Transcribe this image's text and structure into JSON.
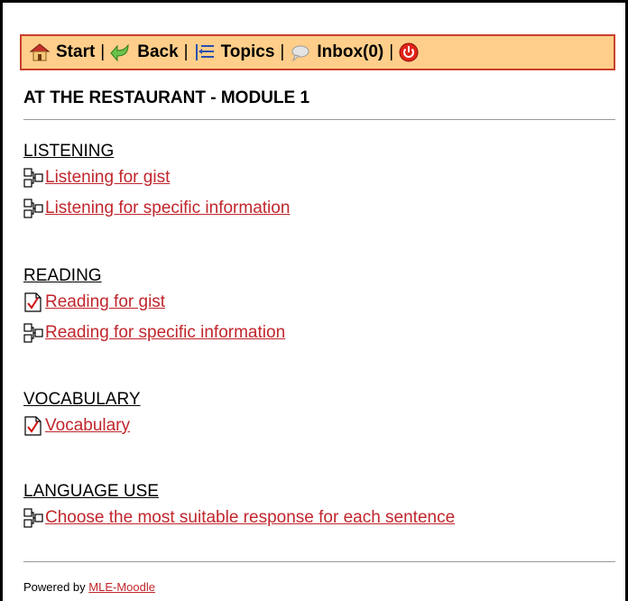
{
  "navbar": {
    "start_label": "Start",
    "back_label": "Back",
    "topics_label": "Topics",
    "inbox_label": "Inbox(0)",
    "separator": "|"
  },
  "page": {
    "title": "AT THE RESTAURANT - MODULE 1"
  },
  "sections": [
    {
      "heading": "LISTENING",
      "items": [
        {
          "icon": "hierarchy-icon",
          "label": "Listening for gist"
        },
        {
          "icon": "hierarchy-icon",
          "label": "Listening for specific information"
        }
      ]
    },
    {
      "heading": "READING",
      "items": [
        {
          "icon": "checked-document-icon",
          "label": "Reading for gist"
        },
        {
          "icon": "hierarchy-icon",
          "label": "Reading for specific information"
        }
      ]
    },
    {
      "heading": "VOCABULARY",
      "items": [
        {
          "icon": "checked-document-icon",
          "label": "Vocabulary"
        }
      ]
    },
    {
      "heading": "LANGUAGE USE",
      "items": [
        {
          "icon": "hierarchy-icon",
          "label": "Choose the most suitable response for each sentence"
        }
      ]
    }
  ],
  "footer": {
    "powered_by": "Powered by",
    "link_label": "MLE-Moodle"
  },
  "colors": {
    "nav_bg": "#ffce8a",
    "nav_border": "#c8402a",
    "link": "#c0262c"
  }
}
